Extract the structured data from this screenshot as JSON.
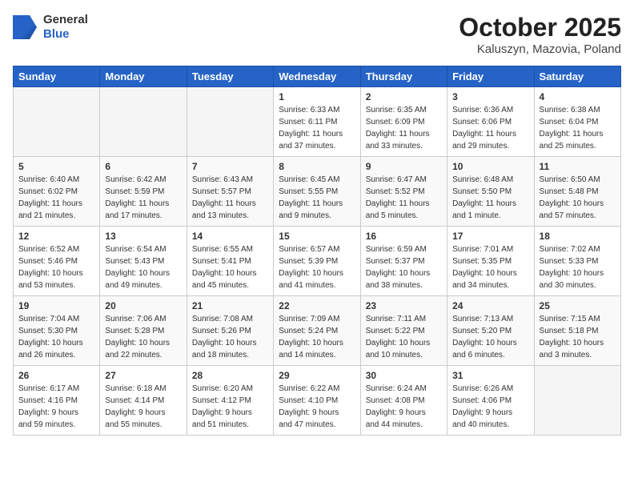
{
  "header": {
    "logo_general": "General",
    "logo_blue": "Blue",
    "month_title": "October 2025",
    "location": "Kaluszyn, Mazovia, Poland"
  },
  "weekdays": [
    "Sunday",
    "Monday",
    "Tuesday",
    "Wednesday",
    "Thursday",
    "Friday",
    "Saturday"
  ],
  "weeks": [
    [
      {
        "day": "",
        "info": ""
      },
      {
        "day": "",
        "info": ""
      },
      {
        "day": "",
        "info": ""
      },
      {
        "day": "1",
        "info": "Sunrise: 6:33 AM\nSunset: 6:11 PM\nDaylight: 11 hours\nand 37 minutes."
      },
      {
        "day": "2",
        "info": "Sunrise: 6:35 AM\nSunset: 6:09 PM\nDaylight: 11 hours\nand 33 minutes."
      },
      {
        "day": "3",
        "info": "Sunrise: 6:36 AM\nSunset: 6:06 PM\nDaylight: 11 hours\nand 29 minutes."
      },
      {
        "day": "4",
        "info": "Sunrise: 6:38 AM\nSunset: 6:04 PM\nDaylight: 11 hours\nand 25 minutes."
      }
    ],
    [
      {
        "day": "5",
        "info": "Sunrise: 6:40 AM\nSunset: 6:02 PM\nDaylight: 11 hours\nand 21 minutes."
      },
      {
        "day": "6",
        "info": "Sunrise: 6:42 AM\nSunset: 5:59 PM\nDaylight: 11 hours\nand 17 minutes."
      },
      {
        "day": "7",
        "info": "Sunrise: 6:43 AM\nSunset: 5:57 PM\nDaylight: 11 hours\nand 13 minutes."
      },
      {
        "day": "8",
        "info": "Sunrise: 6:45 AM\nSunset: 5:55 PM\nDaylight: 11 hours\nand 9 minutes."
      },
      {
        "day": "9",
        "info": "Sunrise: 6:47 AM\nSunset: 5:52 PM\nDaylight: 11 hours\nand 5 minutes."
      },
      {
        "day": "10",
        "info": "Sunrise: 6:48 AM\nSunset: 5:50 PM\nDaylight: 11 hours\nand 1 minute."
      },
      {
        "day": "11",
        "info": "Sunrise: 6:50 AM\nSunset: 5:48 PM\nDaylight: 10 hours\nand 57 minutes."
      }
    ],
    [
      {
        "day": "12",
        "info": "Sunrise: 6:52 AM\nSunset: 5:46 PM\nDaylight: 10 hours\nand 53 minutes."
      },
      {
        "day": "13",
        "info": "Sunrise: 6:54 AM\nSunset: 5:43 PM\nDaylight: 10 hours\nand 49 minutes."
      },
      {
        "day": "14",
        "info": "Sunrise: 6:55 AM\nSunset: 5:41 PM\nDaylight: 10 hours\nand 45 minutes."
      },
      {
        "day": "15",
        "info": "Sunrise: 6:57 AM\nSunset: 5:39 PM\nDaylight: 10 hours\nand 41 minutes."
      },
      {
        "day": "16",
        "info": "Sunrise: 6:59 AM\nSunset: 5:37 PM\nDaylight: 10 hours\nand 38 minutes."
      },
      {
        "day": "17",
        "info": "Sunrise: 7:01 AM\nSunset: 5:35 PM\nDaylight: 10 hours\nand 34 minutes."
      },
      {
        "day": "18",
        "info": "Sunrise: 7:02 AM\nSunset: 5:33 PM\nDaylight: 10 hours\nand 30 minutes."
      }
    ],
    [
      {
        "day": "19",
        "info": "Sunrise: 7:04 AM\nSunset: 5:30 PM\nDaylight: 10 hours\nand 26 minutes."
      },
      {
        "day": "20",
        "info": "Sunrise: 7:06 AM\nSunset: 5:28 PM\nDaylight: 10 hours\nand 22 minutes."
      },
      {
        "day": "21",
        "info": "Sunrise: 7:08 AM\nSunset: 5:26 PM\nDaylight: 10 hours\nand 18 minutes."
      },
      {
        "day": "22",
        "info": "Sunrise: 7:09 AM\nSunset: 5:24 PM\nDaylight: 10 hours\nand 14 minutes."
      },
      {
        "day": "23",
        "info": "Sunrise: 7:11 AM\nSunset: 5:22 PM\nDaylight: 10 hours\nand 10 minutes."
      },
      {
        "day": "24",
        "info": "Sunrise: 7:13 AM\nSunset: 5:20 PM\nDaylight: 10 hours\nand 6 minutes."
      },
      {
        "day": "25",
        "info": "Sunrise: 7:15 AM\nSunset: 5:18 PM\nDaylight: 10 hours\nand 3 minutes."
      }
    ],
    [
      {
        "day": "26",
        "info": "Sunrise: 6:17 AM\nSunset: 4:16 PM\nDaylight: 9 hours\nand 59 minutes."
      },
      {
        "day": "27",
        "info": "Sunrise: 6:18 AM\nSunset: 4:14 PM\nDaylight: 9 hours\nand 55 minutes."
      },
      {
        "day": "28",
        "info": "Sunrise: 6:20 AM\nSunset: 4:12 PM\nDaylight: 9 hours\nand 51 minutes."
      },
      {
        "day": "29",
        "info": "Sunrise: 6:22 AM\nSunset: 4:10 PM\nDaylight: 9 hours\nand 47 minutes."
      },
      {
        "day": "30",
        "info": "Sunrise: 6:24 AM\nSunset: 4:08 PM\nDaylight: 9 hours\nand 44 minutes."
      },
      {
        "day": "31",
        "info": "Sunrise: 6:26 AM\nSunset: 4:06 PM\nDaylight: 9 hours\nand 40 minutes."
      },
      {
        "day": "",
        "info": ""
      }
    ]
  ]
}
